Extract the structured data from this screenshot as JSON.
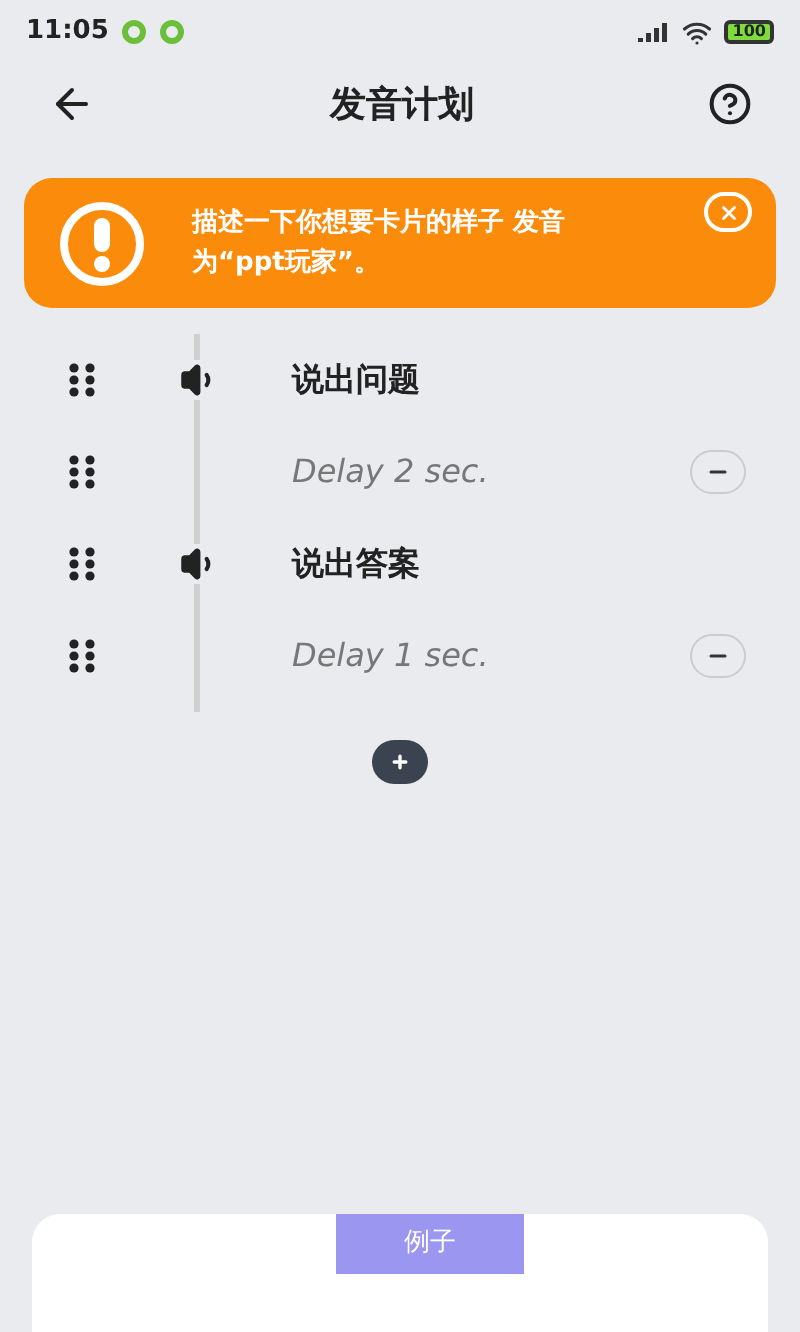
{
  "status_bar": {
    "time": "11:05",
    "battery": "100"
  },
  "header": {
    "title": "发音计划"
  },
  "alert": {
    "message": "描述一下你想要卡片的样子 发音为“ppt玩家”。"
  },
  "steps": [
    {
      "kind": "speak",
      "label": "说出问题"
    },
    {
      "kind": "delay",
      "label": "Delay 2 sec."
    },
    {
      "kind": "speak",
      "label": "说出答案"
    },
    {
      "kind": "delay",
      "label": "Delay 1 sec."
    }
  ],
  "bottom_sheet": {
    "tab": "例子"
  }
}
